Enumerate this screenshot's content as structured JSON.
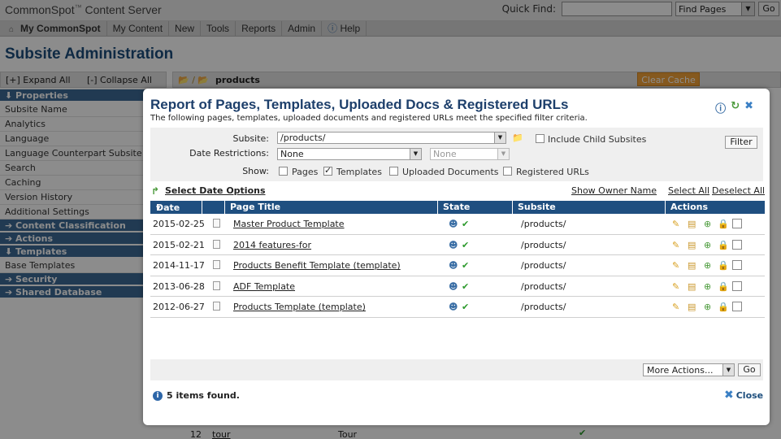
{
  "app": {
    "brand": "CommonSpot",
    "brand_tm": "™",
    "product": " Content Server",
    "quick_find_label": "Quick Find:",
    "find_select": "Find Pages",
    "go": "Go",
    "menu": [
      "My CommonSpot",
      "My Content",
      "New",
      "Tools",
      "Reports",
      "Admin",
      "Help"
    ],
    "page_title": "Subsite Administration",
    "expand_all": "[+] Expand All",
    "collapse_all": "[-] Collapse All",
    "crumb": "products",
    "clear_cache": "Clear Cache",
    "sidebar": [
      {
        "type": "header",
        "label": "⬇ Properties"
      },
      {
        "type": "item",
        "label": "Subsite Name"
      },
      {
        "type": "item",
        "label": "Analytics"
      },
      {
        "type": "item",
        "label": "Language"
      },
      {
        "type": "item",
        "label": "Language Counterpart Subsite"
      },
      {
        "type": "item",
        "label": "Search"
      },
      {
        "type": "item",
        "label": "Caching"
      },
      {
        "type": "item",
        "label": "Version History"
      },
      {
        "type": "item",
        "label": "Additional Settings"
      },
      {
        "type": "header",
        "label": "➔ Content Classification"
      },
      {
        "type": "header",
        "label": "➔ Actions"
      },
      {
        "type": "header",
        "label": "⬇ Templates"
      },
      {
        "type": "item",
        "label": "Base Templates"
      },
      {
        "type": "header",
        "label": "➔ Security"
      },
      {
        "type": "header",
        "label": "➔ Shared Database"
      }
    ],
    "bg_row": {
      "num": "12",
      "name": "tour",
      "title": "Tour"
    }
  },
  "modal": {
    "title": "Report of Pages, Templates, Uploaded Docs & Registered URLs",
    "subtitle": "The following pages, templates, uploaded documents and registered URLs meet the specified filter criteria.",
    "subsite_label": "Subsite:",
    "subsite_value": "/products/",
    "include_child": "Include Child Subsites",
    "date_label": "Date Restrictions:",
    "date_value": "None",
    "date_value2": "None",
    "show_label": "Show:",
    "show_pages": "Pages",
    "show_templates": "Templates",
    "show_uploaded": "Uploaded Documents",
    "show_registered": "Registered URLs",
    "filter_button": "Filter",
    "select_date_options": "Select Date Options",
    "show_owner_name": "Show Owner Name",
    "select_all": "Select All",
    "deselect_all": "Deselect All",
    "columns": {
      "date": "Date",
      "title": "Page Title",
      "state": "State",
      "subsite": "Subsite",
      "actions": "Actions"
    },
    "rows": [
      {
        "date": "2015-02-25",
        "title": "Master Product Template",
        "subsite": "/products/"
      },
      {
        "date": "2015-02-21",
        "title": "2014 features-for",
        "subsite": "/products/"
      },
      {
        "date": "2014-11-17",
        "title": "Products Benefit Template (template)",
        "subsite": "/products/"
      },
      {
        "date": "2013-06-28",
        "title": "ADF Template",
        "subsite": "/products/"
      },
      {
        "date": "2012-06-27",
        "title": "Products Template (template)",
        "subsite": "/products/"
      }
    ],
    "more_actions": "More Actions...",
    "go": "Go",
    "status": "5 items found.",
    "close": "Close"
  }
}
